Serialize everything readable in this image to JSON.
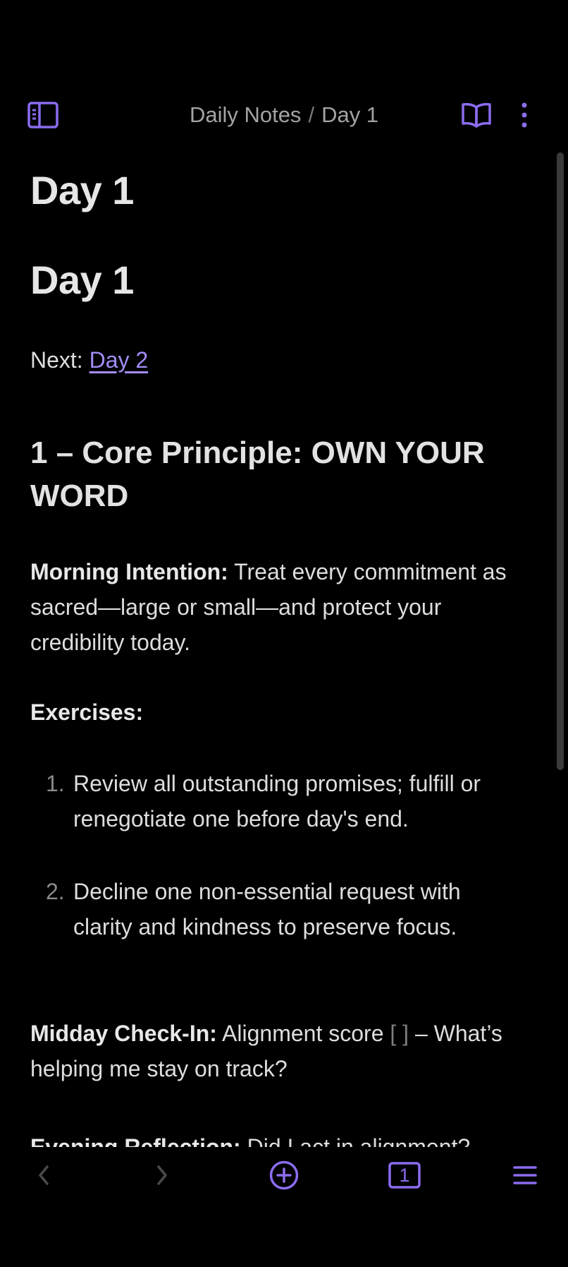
{
  "header": {
    "breadcrumb_folder": "Daily Notes",
    "breadcrumb_separator": "/",
    "breadcrumb_note": "Day 1",
    "left_icon": "sidebar-toggle-icon",
    "reading_icon": "book-open-icon",
    "more_icon": "more-vertical-icon"
  },
  "note": {
    "title": "Day 1",
    "heading1": "Day 1",
    "next_label": "Next: ",
    "next_link": "Day 2",
    "section_heading": "1 – Core Principle: OWN YOUR WORD",
    "morning_label": "Morning Intention:",
    "morning_text": " Treat every commitment as sacred—large or small—and protect your credibility today.",
    "exercises_label": "Exercises:",
    "exercises": [
      {
        "num": "1.",
        "text": "Review all outstanding promises; fulfill or renegotiate one before day's end."
      },
      {
        "num": "2.",
        "text": "Decline one non-essential request with clarity and kindness to preserve focus."
      }
    ],
    "midday_label": "Midday Check-In:",
    "midday_text_before": " Alignment score ",
    "midday_bracket": "[ ]",
    "midday_text_after": " – What’s helping me stay on track?",
    "evening_label": "Evening Reflection:",
    "evening_text": " Did I act in alignment?"
  },
  "bottom_bar": {
    "back_icon": "chevron-left-icon",
    "forward_icon": "chevron-right-icon",
    "new_note_icon": "plus-circle-icon",
    "tabs_count": "1",
    "menu_icon": "menu-icon"
  },
  "colors": {
    "accent": "#8b6cf0",
    "link": "#a48cf5",
    "background": "#000000",
    "text": "#dcddde",
    "muted": "#a3a3a3"
  }
}
